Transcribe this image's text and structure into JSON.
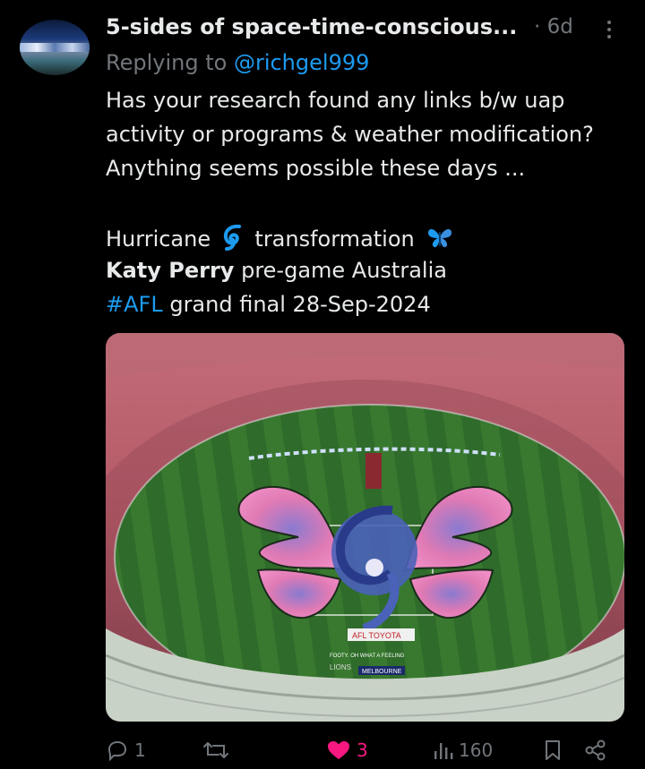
{
  "post": {
    "author_name": "5-sides of space-time-conscious...",
    "time": "· 6d",
    "replying_prefix": "Replying to",
    "replying_handle": "@richgel999",
    "lines": [
      "Has your research found any links b/w uap",
      "activity or programs & weather modification?",
      "Anything seems possible these days ..."
    ],
    "hurricane_word": "Hurricane",
    "transformation_word": "transformation",
    "katy_name": "Katy Perry",
    "katy_rest": " pre-game Australia",
    "hashtag": "#AFL",
    "hashtag_rest": " grand final 28-Sep-2024",
    "emoji": {
      "hurricane": "cyclone-icon",
      "butterfly": "butterfly-icon"
    }
  },
  "media": {
    "description_icons": "stadium-photo",
    "banner_sign_text": "AFL TOYOTA",
    "ground_text_1": "FOOTY. OH WHAT A FEELING",
    "ground_text_2": "MELBOURNE",
    "ground_text_3": "LIONS"
  },
  "actions": {
    "replies": "1",
    "reposts": "",
    "likes": "3",
    "views": "160"
  },
  "colors": {
    "accent": "#1d9bf0",
    "like": "#f91880",
    "muted": "#71767b",
    "text": "#e7e9ea"
  }
}
